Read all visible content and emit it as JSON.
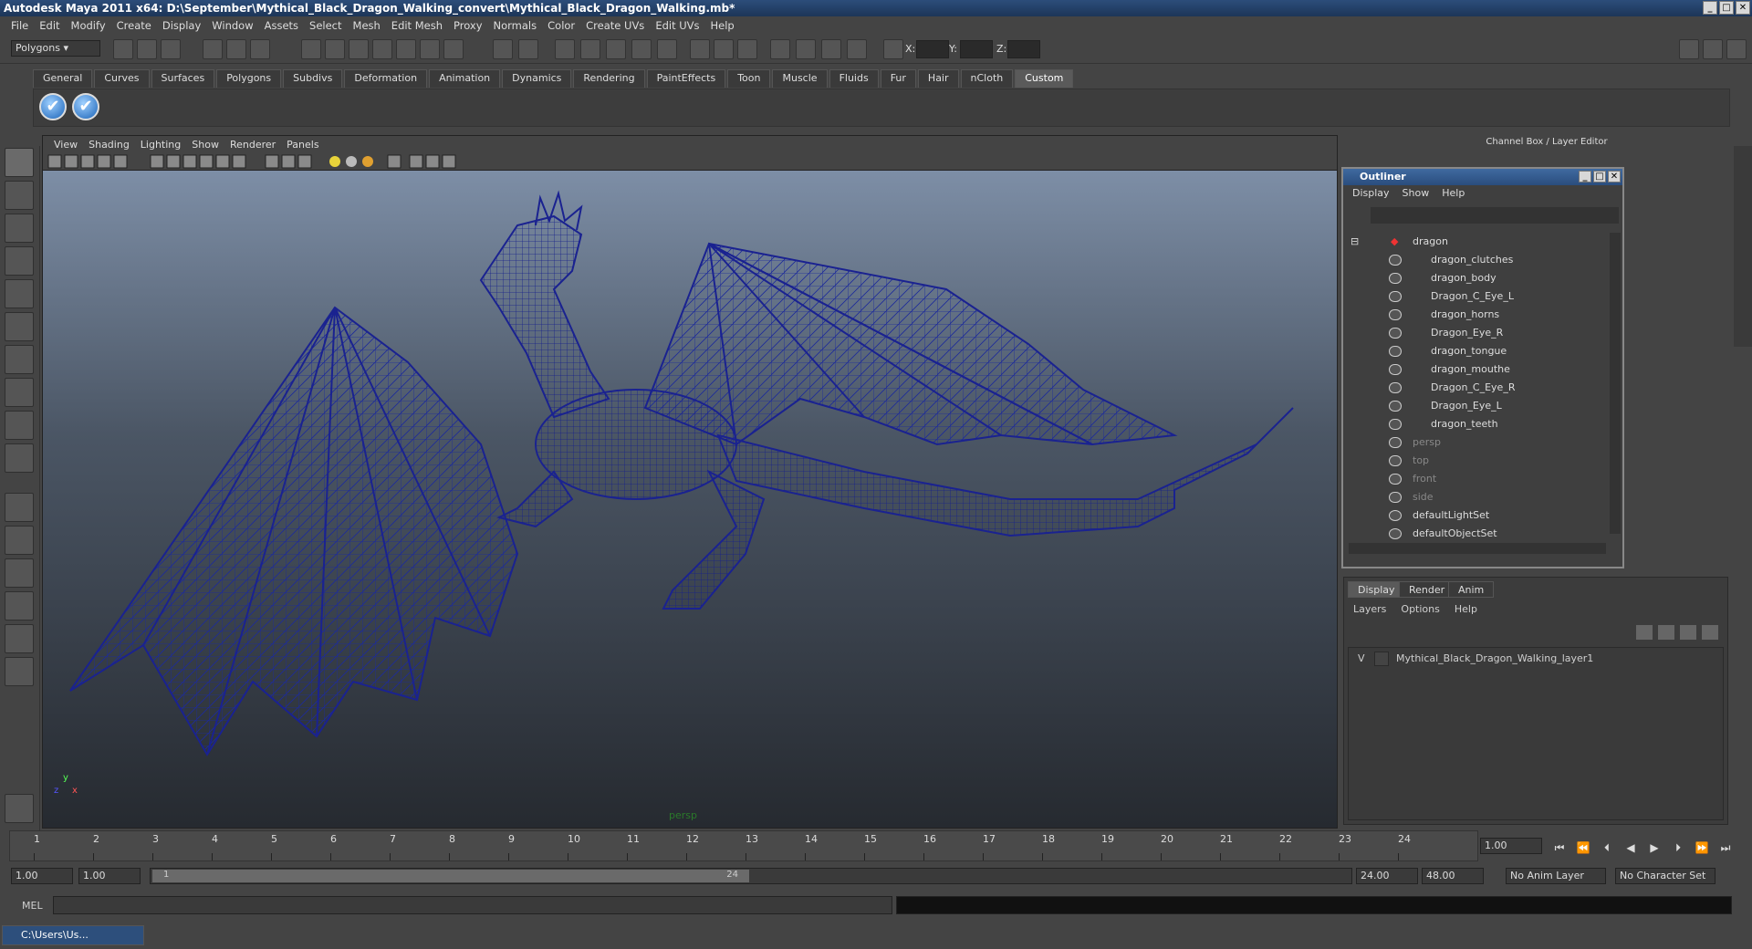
{
  "title": "Autodesk Maya 2011 x64: D:\\September\\Mythical_Black_Dragon_Walking_convert\\Mythical_Black_Dragon_Walking.mb*",
  "menus": [
    "File",
    "Edit",
    "Modify",
    "Create",
    "Display",
    "Window",
    "Assets",
    "Select",
    "Mesh",
    "Edit Mesh",
    "Proxy",
    "Normals",
    "Color",
    "Create UVs",
    "Edit UVs",
    "Help"
  ],
  "status": {
    "mode": "Polygons",
    "x_label": "X:",
    "y_label": "Y:",
    "z_label": "Z:"
  },
  "shelf_tabs": [
    "General",
    "Curves",
    "Surfaces",
    "Polygons",
    "Subdivs",
    "Deformation",
    "Animation",
    "Dynamics",
    "Rendering",
    "PaintEffects",
    "Toon",
    "Muscle",
    "Fluids",
    "Fur",
    "Hair",
    "nCloth",
    "Custom"
  ],
  "viewport": {
    "menus": [
      "View",
      "Shading",
      "Lighting",
      "Show",
      "Renderer",
      "Panels"
    ],
    "camera": "persp",
    "axis_y": "y",
    "axis_x": "x",
    "axis_z": "z"
  },
  "channel_box_title": "Channel Box / Layer Editor",
  "outliner": {
    "title": "Outliner",
    "menus": [
      "Display",
      "Show",
      "Help"
    ],
    "items": [
      {
        "name": "dragon"
      },
      {
        "name": "dragon_clutches"
      },
      {
        "name": "dragon_body"
      },
      {
        "name": "Dragon_C_Eye_L"
      },
      {
        "name": "dragon_horns"
      },
      {
        "name": "Dragon_Eye_R"
      },
      {
        "name": "dragon_tongue"
      },
      {
        "name": "dragon_mouthe"
      },
      {
        "name": "Dragon_C_Eye_R"
      },
      {
        "name": "Dragon_Eye_L"
      },
      {
        "name": "dragon_teeth"
      },
      {
        "name": "persp"
      },
      {
        "name": "top"
      },
      {
        "name": "front"
      },
      {
        "name": "side"
      },
      {
        "name": "defaultLightSet"
      },
      {
        "name": "defaultObjectSet"
      }
    ]
  },
  "layers": {
    "tabs": [
      "Display",
      "Render",
      "Anim"
    ],
    "menus": [
      "Layers",
      "Options",
      "Help"
    ],
    "visible_flag": "V",
    "layer_name": "Mythical_Black_Dragon_Walking_layer1"
  },
  "timeline": {
    "ticks": [
      "1",
      "2",
      "3",
      "4",
      "5",
      "6",
      "7",
      "8",
      "9",
      "10",
      "11",
      "12",
      "13",
      "14",
      "15",
      "16",
      "17",
      "18",
      "19",
      "20",
      "21",
      "22",
      "23",
      "24"
    ],
    "current_frame": "1.00",
    "start_field": "1",
    "end_field": "24"
  },
  "range": {
    "start": "1.00",
    "start2": "1.00",
    "end": "24.00",
    "end2": "48.00",
    "anim_layer": "No Anim Layer",
    "char_set": "No Character Set"
  },
  "mel_label": "MEL",
  "taskbar_item": "C:\\Users\\Us..."
}
